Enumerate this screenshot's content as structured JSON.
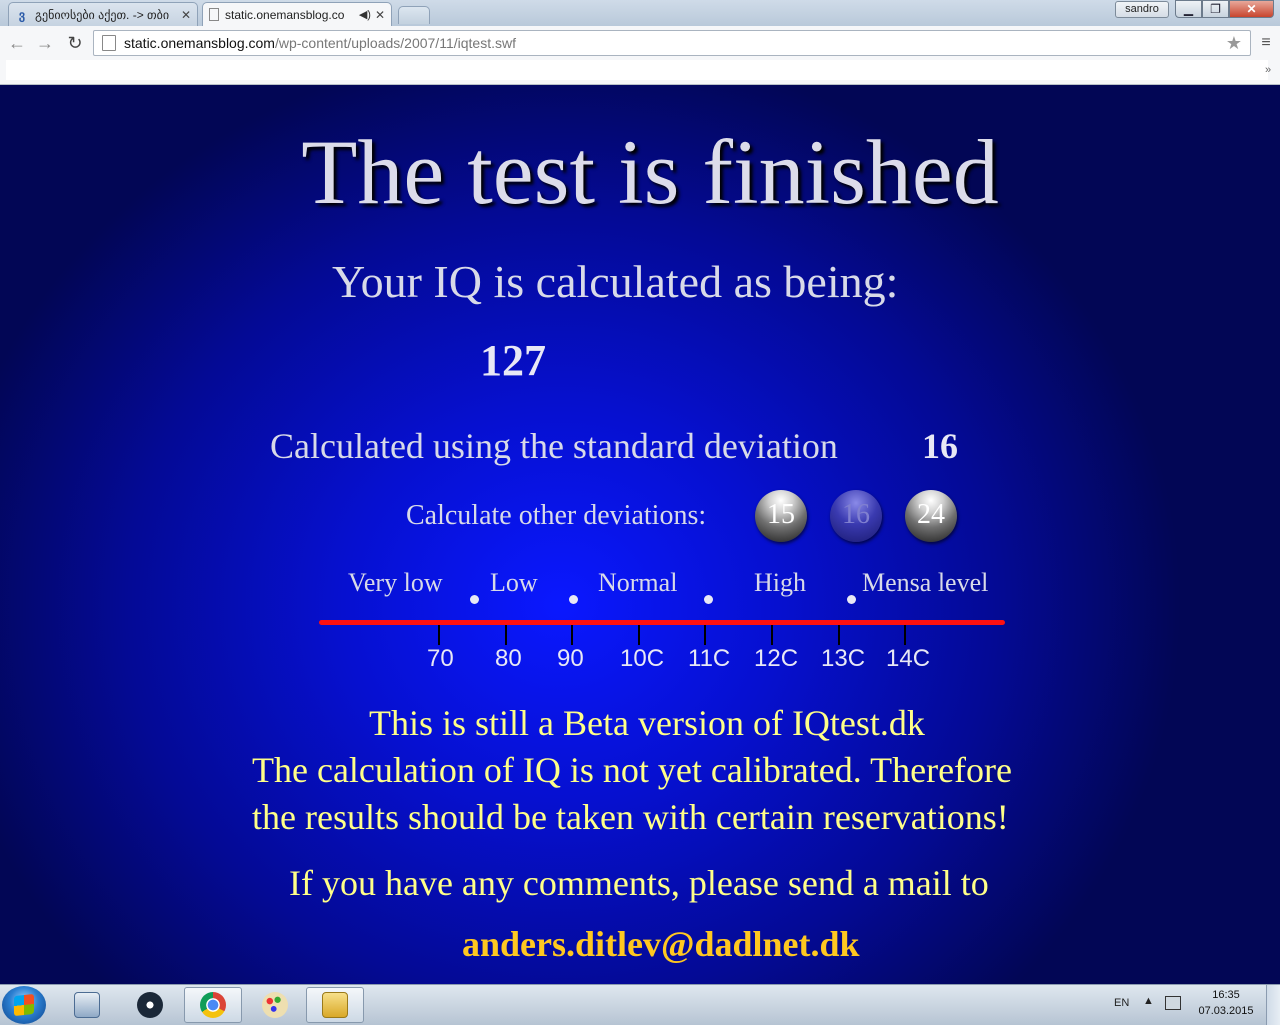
{
  "browser": {
    "tabs": [
      {
        "title": "გენიოსები აქეთ. -> თბი",
        "active": false,
        "favicon": "bookmark-icon"
      },
      {
        "title": "static.onemansblog.co",
        "active": true,
        "favicon": "page-icon",
        "audio": true
      }
    ],
    "profile_name": "sandro",
    "url_host": "static.onemansblog.com",
    "url_path": "/wp-content/uploads/2007/11/iqtest.swf",
    "bookmark_overflow": "»"
  },
  "iqtest": {
    "headline": "The test is finished",
    "iq_label": "Your IQ is calculated as being:",
    "iq_value": "127",
    "sd_label": "Calculated using the standard deviation",
    "sd_value": "16",
    "other_label": "Calculate other deviations:",
    "deviation_buttons": [
      {
        "label": "15",
        "active": false
      },
      {
        "label": "16",
        "active": true
      },
      {
        "label": "24",
        "active": false
      }
    ],
    "ranges": [
      "Very low",
      "Low",
      "Normal",
      "High",
      "Mensa level"
    ],
    "ticks": [
      "70",
      "80",
      "90",
      "10C",
      "11C",
      "12C",
      "13C",
      "14C"
    ],
    "beta_line1": "This is still a Beta version of IQtest.dk",
    "beta_line2": "The calculation of IQ is not yet calibrated. Therefore",
    "beta_line3": "the results should be taken with certain reservations!",
    "mail_note": "If you have any comments, please send a mail to",
    "email": "anders.ditlev@dadlnet.dk",
    "colors": {
      "background": "#0610d0",
      "scale_line": "#ff1010",
      "notice_text": "#ffff88",
      "email": "#ffc820"
    }
  },
  "taskbar": {
    "apps": [
      "calculator-icon",
      "steam-icon",
      "chrome-icon",
      "paint-icon",
      "explorer-icon"
    ],
    "language": "EN",
    "time": "16:35",
    "date": "07.03.2015"
  }
}
